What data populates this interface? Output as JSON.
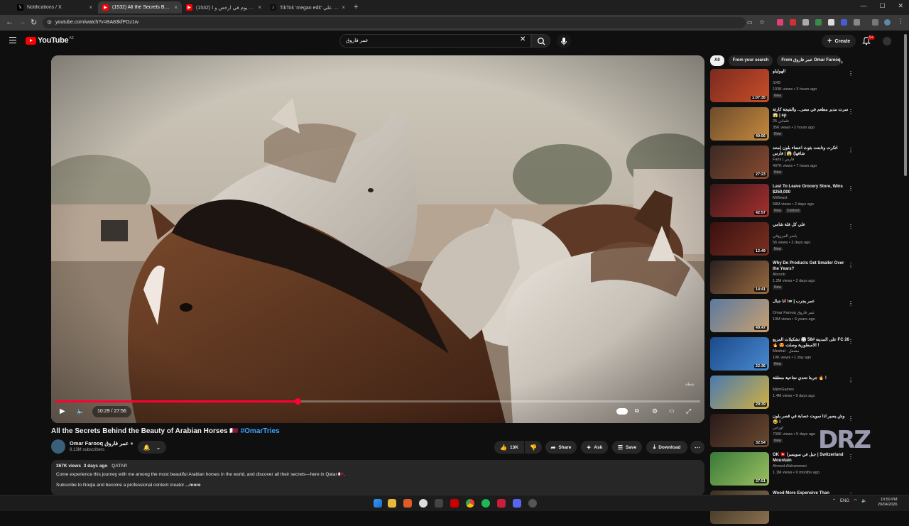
{
  "browser": {
    "tabs": [
      {
        "title": "Notifications / X",
        "favicon": "x-icon",
        "active": false
      },
      {
        "title": "(1532) All the Secrets Behind th",
        "favicon": "youtube-icon",
        "active": true
      },
      {
        "title": "(1532) حجزت يوم في ارخص و ا",
        "favicon": "youtube-icon",
        "active": false
      },
      {
        "title": "TikTok 'megan edit' علي اشتر علي",
        "favicon": "tiktok-icon",
        "active": false
      }
    ],
    "url": "youtube.com/watch?v=BA83kfPOz1w",
    "close_glyph": "×",
    "new_tab_glyph": "+"
  },
  "youtube": {
    "logo_text": "YouTube",
    "logo_country": "AE",
    "search_value": "عمر فاروق",
    "create_label": "Create",
    "notif_badge": "9+"
  },
  "player": {
    "time_current": "10:29",
    "time_total": "27:56",
    "progress": 0.3755,
    "watermark": "نقطة"
  },
  "video": {
    "title": "All the Secrets Behind the Beauty of Arabian Horses 🇶🇦",
    "hashtag": "#OmarTries",
    "channel": "Omar Farooq عمر فاروق",
    "subscribers": "8.13M subscribers",
    "likes": "13K",
    "share_label": "Share",
    "ask_label": "Ask",
    "save_label": "Save",
    "download_label": "Download",
    "views": "367K views",
    "date": "3 days ago",
    "location": "QATAR",
    "description_line1": "Come experience this journey with me among the most beautiful Arabian horses in the world, and discover all their secrets—here in Qatar 🇶🇦.",
    "description_line2": "Subscribe to Noqta and become a professional content creator",
    "more_label": "...more"
  },
  "sidebar": {
    "chips": [
      "All",
      "From your search",
      "From عمر فاروق Omar Farooq"
    ],
    "items": [
      {
        "title": "الهوليلو",
        "channel": "SXB",
        "meta": "103K views • 3 hours ago",
        "badge": "New",
        "badge2": "",
        "duration": "1:07:35",
        "color1": "#7a2a1e",
        "color2": "#c94e2a"
      },
      {
        "title": "سرت مدير مطعم في مصر... والنتيجة كارثة 😱 | ep",
        "channel": "عثماني 25",
        "meta": "35K views • 2 hours ago",
        "badge": "New",
        "badge2": "",
        "duration": "40:56",
        "color1": "#6d4b2c",
        "color2": "#c58a3e"
      },
      {
        "title": "اتكرت وتابعت بثوث اعضاء بلون (محد شافها) 😱 | فارس",
        "channel": "Faris | فارس",
        "meta": "407K views • 7 hours ago",
        "badge": "New",
        "badge2": "",
        "duration": "27:23",
        "color1": "#3a2a24",
        "color2": "#8a4a30"
      },
      {
        "title": "Last To Leave Grocery Store, Wins $250,000",
        "channel": "MrBeast",
        "meta": "58M views • 2 days ago",
        "badge": "New",
        "badge2": "Dubbed",
        "duration": "42:57",
        "color1": "#3a1818",
        "color2": "#a83030"
      },
      {
        "title": "علي كل فلة شامي",
        "channel": "ياسر المرزوقي",
        "meta": "56 views • 2 days ago",
        "badge": "New",
        "badge2": "",
        "duration": "12:49",
        "color1": "#3a1010",
        "color2": "#7a3020"
      },
      {
        "title": "Why Do Products Get Smaller Over the Years?",
        "channel": "Abroob",
        "meta": "1.2M views • 2 days ago",
        "badge": "New",
        "badge2": "",
        "duration": "14:41",
        "color1": "#2a2020",
        "color2": "#9a6a40"
      },
      {
        "title": "أنا جبال 🇯🇴 | عمر يجرب",
        "channel": "Omar Farooq عمر فاروق",
        "meta": "10M views • 6 years ago",
        "badge": "",
        "badge2": "",
        "duration": "49:47",
        "color1": "#5a7aa0",
        "color2": "#c9a070"
      },
      {
        "title": "على المدينة #58 🏟 تشكيلات المربع FC 26 🔥 😍 الاسطورية وصلت !",
        "channel": "Meshal - مشعل",
        "meta": "10K views • 1 day ago",
        "badge": "New",
        "badge2": "",
        "duration": "22:36",
        "color1": "#1a4a8a",
        "color2": "#4a8ad0"
      },
      {
        "title": "جربنا تحدي نجاحية منطقة 🔥 !",
        "channel": "MjrmGames",
        "meta": "1.4M views • 9 days ago",
        "badge": "",
        "badge2": "",
        "duration": "29:39",
        "color1": "#4a7ab0",
        "color2": "#d0b040"
      },
      {
        "title": "وش يصير اذا سويت عصابة في قصر بلون 😂 !",
        "channel": "اورجي",
        "meta": "730K views • 5 days ago",
        "badge": "New",
        "badge2": "",
        "duration": "32:54",
        "color1": "#2a1a1a",
        "color2": "#6a4a30"
      },
      {
        "title": "OK 🇨🇭 جبل في سويسرا | Switzerland Mountain",
        "channel": "Ahmed Alshammari",
        "meta": "1.1M views • 9 months ago",
        "badge": "",
        "badge2": "",
        "duration": "37:51",
        "color1": "#3a7a3a",
        "color2": "#9ac060"
      },
      {
        "title": "Wood More Expensive Than",
        "channel": "",
        "meta": "",
        "badge": "",
        "badge2": "",
        "duration": "",
        "color1": "#3a3020",
        "color2": "#8a7050"
      }
    ]
  },
  "taskbar": {
    "lang": "ENG",
    "time": "10:59 PM",
    "date": "20/04/2026"
  },
  "overlay_logo": "DRZ"
}
